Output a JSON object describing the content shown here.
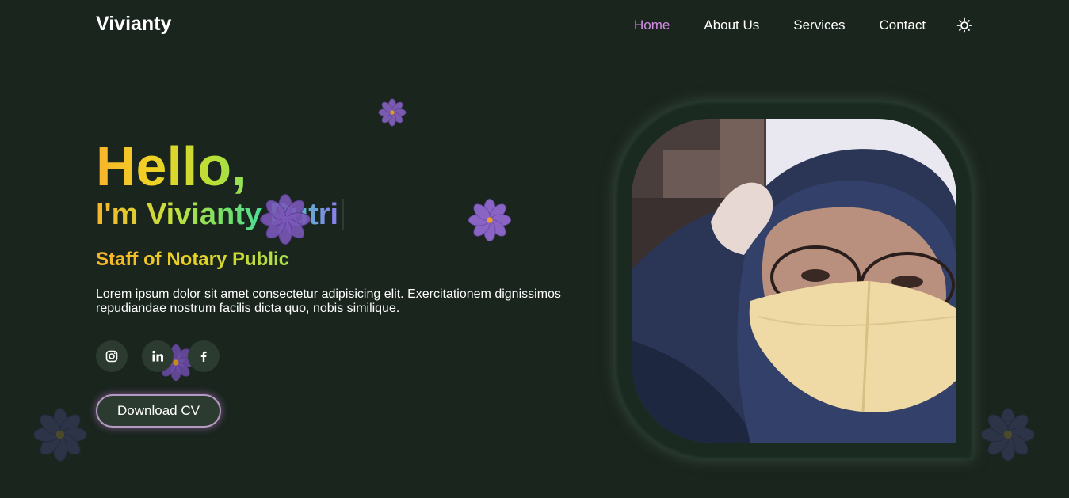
{
  "header": {
    "brand": "Vivianty",
    "nav": [
      "Home",
      "About Us",
      "Services",
      "Contact"
    ],
    "active_nav": "Home",
    "theme_toggle_icon": "sun-icon"
  },
  "hero": {
    "greeting": "Hello,",
    "name": "I'm Vivianty Putri",
    "role": "Staff of Notary Public",
    "description": "Lorem ipsum dolor sit amet consectetur adipisicing elit. Exercitationem dignissimos repudiandae nostrum facilis dicta quo, nobis similique.",
    "socials": [
      "instagram-icon",
      "linkedin-icon",
      "facebook-icon"
    ],
    "download_label": "Download CV"
  },
  "colors": {
    "background": "#1a251e",
    "accent": "#d58be6",
    "button_bg": "#2c3b2f"
  }
}
